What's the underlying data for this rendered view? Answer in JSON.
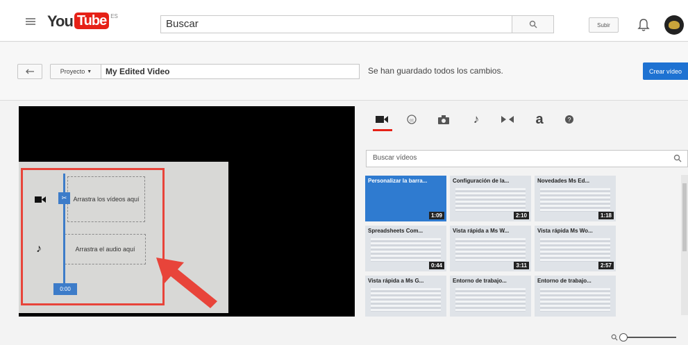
{
  "header": {
    "logo_you": "You",
    "logo_tube": "Tube",
    "logo_region": "ES",
    "search_placeholder": "Buscar",
    "upload_label": "Subir",
    "icons": [
      "menu-icon",
      "search-icon",
      "bell-icon",
      "avatar"
    ]
  },
  "project": {
    "menu_label": "Proyecto",
    "title_value": "My Edited Video",
    "save_status": "Se han guardado todos los cambios.",
    "create_label": "Crear vídeo"
  },
  "timeline": {
    "video_drop": "Arrastra los vídeos aquí",
    "audio_drop": "Arrastra el audio aquí",
    "time": "0:00"
  },
  "panel": {
    "tabs": [
      "video-camera-icon",
      "creative-commons-icon",
      "camera-icon",
      "music-note-icon",
      "transition-icon",
      "text-icon",
      "help-icon"
    ],
    "search_placeholder": "Buscar vídeos",
    "videos": [
      {
        "title": "Personalizar la barra...",
        "duration": "1:09"
      },
      {
        "title": "Configuración de la...",
        "duration": "2:10"
      },
      {
        "title": "Novedades Ms Ed...",
        "duration": "1:18"
      },
      {
        "title": "Spreadsheets Com...",
        "duration": "0:44"
      },
      {
        "title": "Vista rápida a Ms W...",
        "duration": "3:11"
      },
      {
        "title": "Vista rápida Ms Wo...",
        "duration": "2:57"
      },
      {
        "title": "Vista rápida a Ms G...",
        "duration": ""
      },
      {
        "title": "Entorno de trabajo...",
        "duration": ""
      },
      {
        "title": "Entorno de trabajo...",
        "duration": ""
      }
    ]
  },
  "colors": {
    "accent_red": "#e62117",
    "primary_blue": "#1e72d2",
    "highlight_red": "#e8443a",
    "playhead_blue": "#3d7cc9"
  }
}
